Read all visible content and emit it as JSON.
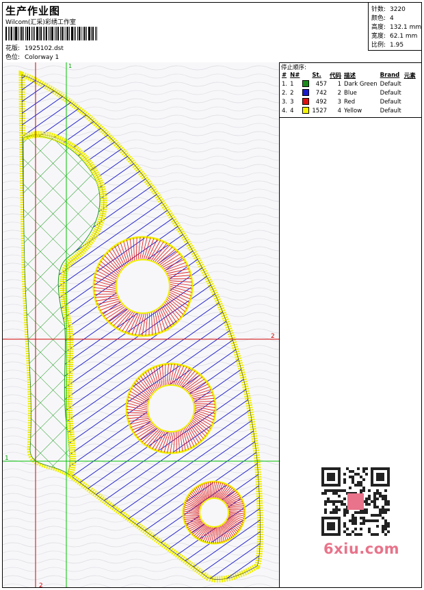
{
  "header": {
    "title": "生产作业图",
    "company": "Wilcom(汇采)彩绣工作室",
    "design_label": "花版:",
    "design_value": "1925102.dst",
    "colorway_label": "色位:",
    "colorway_value": "Colorway 1"
  },
  "stats": {
    "stitches_label": "针数:",
    "stitches_value": "3220",
    "colors_label": "颜色:",
    "colors_value": "4",
    "height_label": "高度:",
    "height_value": "132.1 mm",
    "width_label": "宽度:",
    "width_value": "62.1 mm",
    "scale_label": "比例:",
    "scale_value": "1.95"
  },
  "stop_sequence": {
    "title": "停止顺序:",
    "columns": [
      "#",
      "N#",
      "St.",
      "代码",
      "描述",
      "Brand",
      "元素"
    ],
    "rows": [
      {
        "idx": "1.",
        "n": "1",
        "color": "#1a8a1a",
        "st": "457",
        "code": "1",
        "desc": "Dark Green",
        "brand": "Default"
      },
      {
        "idx": "2.",
        "n": "2",
        "color": "#1a1acc",
        "st": "742",
        "code": "2",
        "desc": "Blue",
        "brand": "Default"
      },
      {
        "idx": "3.",
        "n": "3",
        "color": "#e01010",
        "st": "492",
        "code": "3",
        "desc": "Red",
        "brand": "Default"
      },
      {
        "idx": "4.",
        "n": "4",
        "color": "#f5f500",
        "st": "1527",
        "code": "4",
        "desc": "Yellow",
        "brand": "Default"
      }
    ]
  },
  "guides": {
    "top_marker": "1",
    "right_marker": "2",
    "left_marker": "1",
    "bottom_marker": "2"
  },
  "watermark": "6xiu.com",
  "colors": {
    "green": "#1a9a1a",
    "blue": "#2424d0",
    "red": "#e01010",
    "yellow": "#f0f000",
    "guide_red": "#d00000",
    "guide_green": "#00c000"
  }
}
